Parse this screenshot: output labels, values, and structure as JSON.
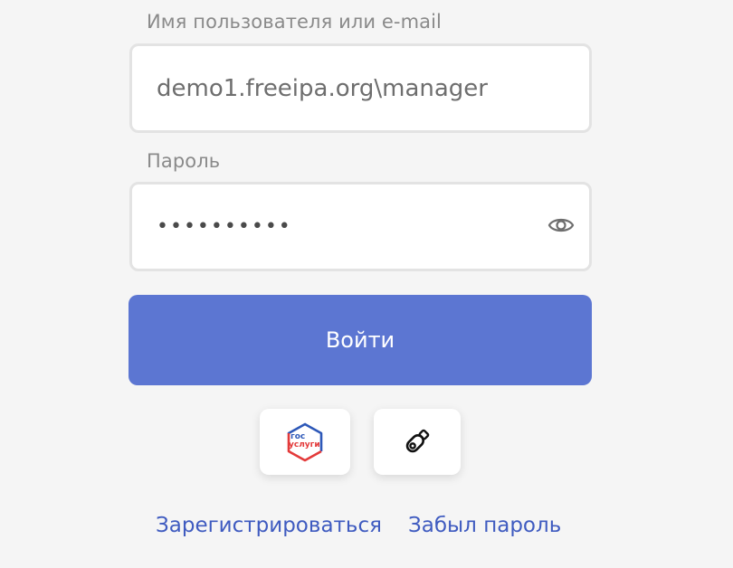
{
  "form": {
    "username_label": "Имя пользователя или e-mail",
    "username_value": "demo1.freeipa.org\\manager",
    "password_label": "Пароль",
    "password_value": "••••••••••",
    "submit_label": "Войти"
  },
  "alt_login": {
    "gosuslugi_line1": "гос",
    "gosuslugi_line2": "услуги"
  },
  "links": {
    "register": "Зарегистрироваться",
    "forgot_password": "Забыл пароль"
  },
  "colors": {
    "primary": "#5c76d2",
    "link": "#3f5bc0",
    "gos_blue": "#2d58b8",
    "gos_red": "#e33a3a"
  },
  "icons": {
    "password_toggle": "eye-icon",
    "gosuslugi": "gosuslugi-logo-icon",
    "key": "usb-key-icon"
  }
}
